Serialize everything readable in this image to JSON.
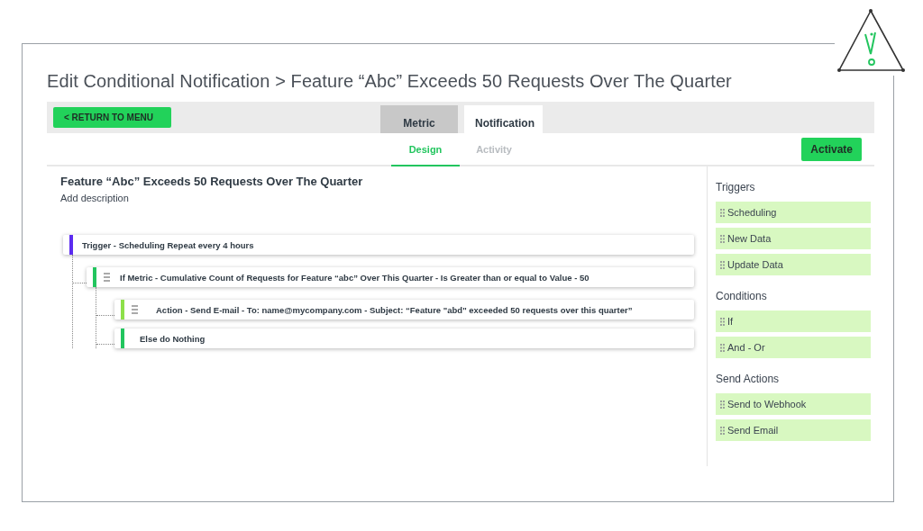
{
  "page_title": "Edit Conditional Notification > Feature “Abc” Exceeds 50 Requests Over The Quarter",
  "return_button": "< RETURN TO MENU",
  "tabs": [
    {
      "label": "Metric",
      "selected": false
    },
    {
      "label": "Notification",
      "selected": true
    }
  ],
  "subtabs": [
    {
      "label": "Design",
      "selected": true
    },
    {
      "label": "Activity",
      "selected": false
    }
  ],
  "activate_button": "Activate",
  "notification": {
    "title": "Feature “Abc” Exceeds 50 Requests Over The Quarter",
    "description": "Add description"
  },
  "tree": [
    {
      "kind": "trigger",
      "text": "Trigger - Scheduling Repeat every 4 hours",
      "color": "#5b2bf0",
      "handle": false,
      "children": [
        {
          "kind": "condition",
          "text": "If Metric - Cumulative Count of Requests for Feature “abc” Over This Quarter - Is Greater than or equal to Value - 50",
          "color": "#22c55e",
          "handle": true,
          "children": [
            {
              "kind": "action",
              "text": "Action - Send E-mail - To: name@mycompany.com - Subject: “Feature \"abd\" exceeded 50 requests over this quarter”",
              "color": "#8ee04a",
              "handle": true
            },
            {
              "kind": "else",
              "text": "Else do Nothing",
              "color": "#22c55e",
              "handle": false
            }
          ]
        }
      ]
    }
  ],
  "palette": [
    {
      "heading": "Triggers",
      "items": [
        "Scheduling",
        "New Data",
        "Update Data"
      ]
    },
    {
      "heading": "Conditions",
      "items": [
        "If",
        "And - Or"
      ]
    },
    {
      "heading": "Send Actions",
      "items": [
        "Send to Webhook",
        "Send Email"
      ]
    }
  ]
}
